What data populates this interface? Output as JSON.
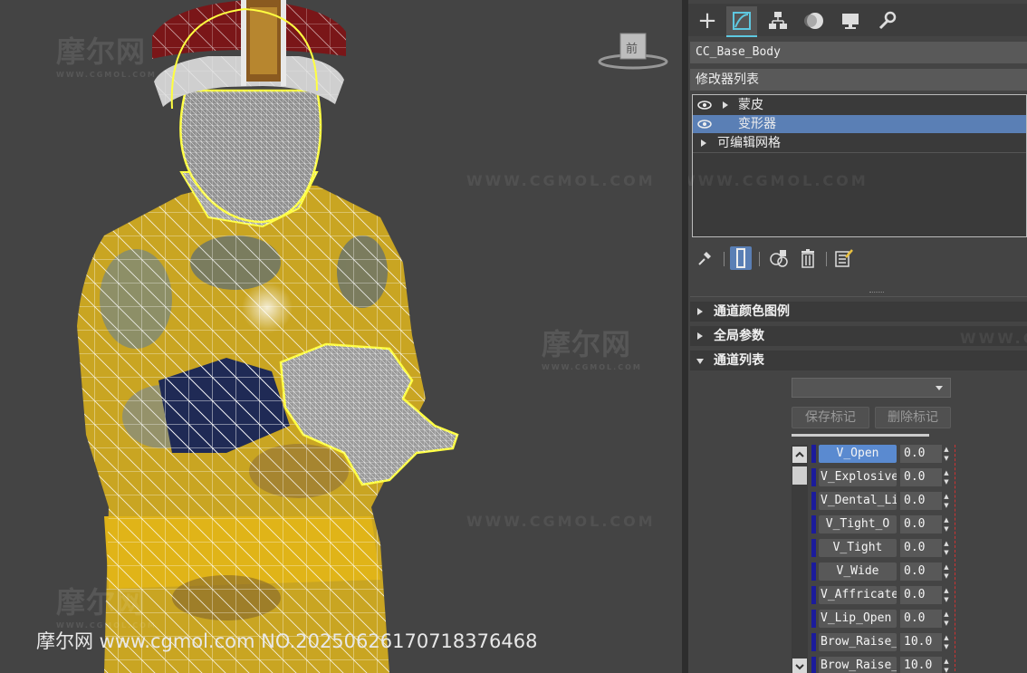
{
  "watermark": {
    "brand": "摩尔网",
    "brand_small": "WWW.CGMOL.COM",
    "url": "WWW.CGMOL.COM",
    "footer": "摩尔网 www.cgmol.com NO.20250626170718376468"
  },
  "viewcube_label": "前",
  "panel": {
    "tabs": [
      {
        "icon": "plus-icon",
        "label": "+"
      },
      {
        "icon": "modify-icon",
        "label": ""
      },
      {
        "icon": "hierarchy-icon",
        "label": ""
      },
      {
        "icon": "motion-icon",
        "label": ""
      },
      {
        "icon": "display-icon",
        "label": ""
      },
      {
        "icon": "utilities-icon",
        "label": ""
      }
    ],
    "object_name": "CC_Base_Body",
    "modifier_list_label": "修改器列表",
    "stack": [
      {
        "label": "蒙皮",
        "eye": true,
        "expand": true,
        "selected": false
      },
      {
        "label": "变形器",
        "eye": true,
        "expand": false,
        "selected": true
      },
      {
        "label": "可编辑网格",
        "eye": false,
        "expand": true,
        "selected": false
      }
    ],
    "rollouts": [
      {
        "label": "通道颜色图例",
        "expanded": false
      },
      {
        "label": "全局参数",
        "expanded": false
      },
      {
        "label": "通道列表",
        "expanded": true
      }
    ],
    "save_marker": "保存标记",
    "delete_marker": "删除标记",
    "channels": [
      {
        "name": "V_Open",
        "value": "0.0",
        "active": true
      },
      {
        "name": "V_Explosive",
        "value": "0.0",
        "active": false
      },
      {
        "name": "V_Dental_Li",
        "value": "0.0",
        "active": false
      },
      {
        "name": "V_Tight_O",
        "value": "0.0",
        "active": false
      },
      {
        "name": "V_Tight",
        "value": "0.0",
        "active": false
      },
      {
        "name": "V_Wide",
        "value": "0.0",
        "active": false
      },
      {
        "name": "V_Affricate",
        "value": "0.0",
        "active": false
      },
      {
        "name": "V_Lip_Open",
        "value": "0.0",
        "active": false
      },
      {
        "name": "Brow_Raise_",
        "value": "10.0",
        "active": false
      },
      {
        "name": "Brow_Raise_",
        "value": "10.0",
        "active": false
      }
    ]
  }
}
